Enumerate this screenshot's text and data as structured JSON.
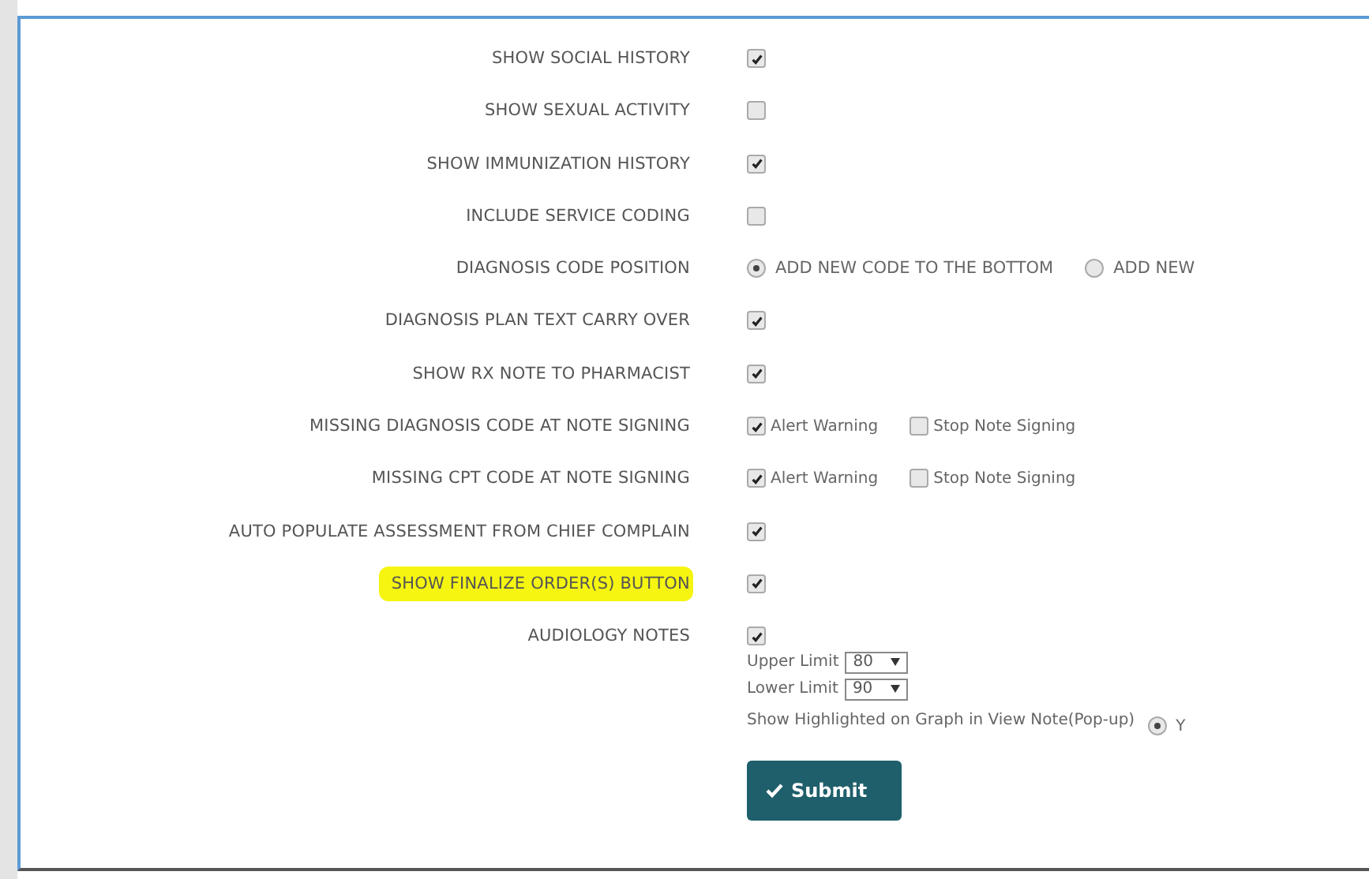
{
  "rows": [
    {
      "label": "SHOW SOCIAL HISTORY",
      "kind": "checkbox",
      "checked": true
    },
    {
      "label": "SHOW SEXUAL ACTIVITY",
      "kind": "checkbox",
      "checked": false
    },
    {
      "label": "SHOW IMMUNIZATION HISTORY",
      "kind": "checkbox",
      "checked": true
    },
    {
      "label": "INCLUDE SERVICE CODING",
      "kind": "checkbox",
      "checked": false
    },
    {
      "label": "DIAGNOSIS CODE POSITION",
      "kind": "radio",
      "options": [
        {
          "label": "ADD NEW CODE TO THE BOTTOM",
          "selected": true
        },
        {
          "label": "ADD NEW",
          "selected": false
        }
      ]
    },
    {
      "label": "DIAGNOSIS PLAN TEXT CARRY OVER",
      "kind": "checkbox",
      "checked": true
    },
    {
      "label": "SHOW RX NOTE TO PHARMACIST",
      "kind": "checkbox",
      "checked": true
    },
    {
      "label": "MISSING DIAGNOSIS CODE AT NOTE SIGNING",
      "kind": "pair",
      "options": [
        {
          "label": "Alert Warning",
          "checked": true
        },
        {
          "label": "Stop Note Signing",
          "checked": false
        }
      ]
    },
    {
      "label": "MISSING CPT CODE AT NOTE SIGNING",
      "kind": "pair",
      "options": [
        {
          "label": "Alert Warning",
          "checked": true
        },
        {
          "label": "Stop Note Signing",
          "checked": false
        }
      ]
    },
    {
      "label": "AUTO POPULATE ASSESSMENT FROM CHIEF COMPLAIN",
      "kind": "checkbox",
      "checked": true
    },
    {
      "label": "SHOW FINALIZE ORDER(S) BUTTON",
      "kind": "checkbox",
      "checked": true,
      "highlighted": true
    },
    {
      "label": "AUDIOLOGY NOTES",
      "kind": "audiology",
      "checked": true,
      "limits": [
        {
          "label": "Upper Limit",
          "value": "80"
        },
        {
          "label": "Lower Limit",
          "value": "90"
        }
      ],
      "graph": {
        "label": "Show Highlighted on Graph in View Note(Pop-up)",
        "options": [
          {
            "label": "Y",
            "selected": true
          }
        ]
      }
    }
  ],
  "submit": "Submit"
}
